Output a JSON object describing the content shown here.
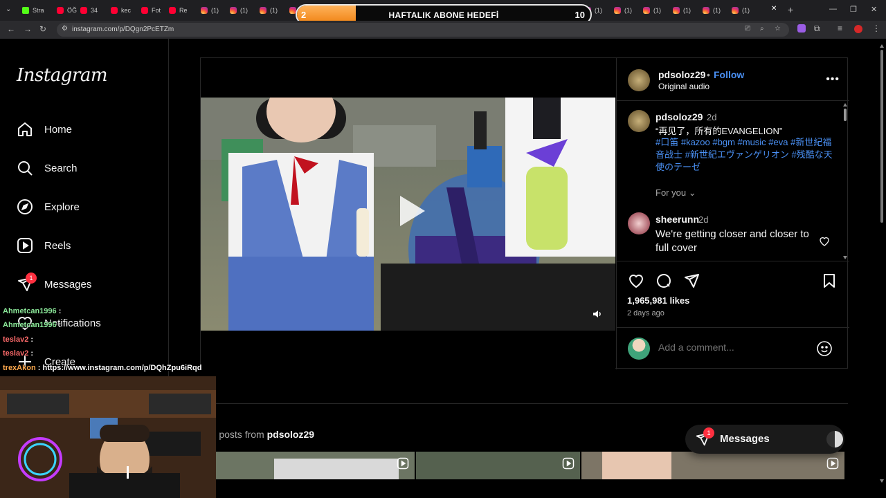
{
  "browser": {
    "tabs": [
      {
        "icon": "kick",
        "title": "Stra"
      },
      {
        "icon": "youtube",
        "title": "ÖĞ"
      },
      {
        "icon": "youtube",
        "title": "34"
      },
      {
        "icon": "youtube",
        "title": "kec"
      },
      {
        "icon": "youtube",
        "title": "Fot"
      },
      {
        "icon": "youtube",
        "title": "Re"
      },
      {
        "icon": "instagram",
        "title": "(1)"
      },
      {
        "icon": "instagram",
        "title": "(1)"
      },
      {
        "icon": "instagram",
        "title": "(1)"
      },
      {
        "icon": "instagram",
        "title": "(1)"
      },
      {
        "icon": "instagram",
        "title": "(1)"
      },
      {
        "icon": "instagram",
        "title": "(1)"
      },
      {
        "icon": "instagram",
        "title": "(1)"
      },
      {
        "icon": "instagram",
        "title": "(1)"
      },
      {
        "icon": "instagram",
        "title": "(1)"
      },
      {
        "icon": "instagram",
        "title": "(1)"
      },
      {
        "icon": "instagram",
        "title": "(1)"
      },
      {
        "icon": "instagram",
        "title": "(1)"
      },
      {
        "icon": "instagram",
        "title": "(1)"
      },
      {
        "icon": "instagram",
        "title": "(1)"
      },
      {
        "icon": "instagram",
        "title": "(1)"
      },
      {
        "icon": "instagram",
        "title": "(1)"
      },
      {
        "icon": "instagram",
        "title": "(1)"
      },
      {
        "icon": "instagram",
        "title": "(1)"
      },
      {
        "icon": "instagram",
        "title": "(1)"
      }
    ],
    "url": "instagram.com/p/DQgn2PcETZm",
    "tab_dropdown": "⌄",
    "new_tab": "+"
  },
  "goal": {
    "title": "HAFTALIK ABONE HEDEFİ",
    "current": "2",
    "target": "10",
    "progress_fraction": 0.2,
    "accent": "#f08314"
  },
  "sidebar": {
    "logo": "Instagram",
    "items": [
      {
        "icon": "home-icon",
        "label": "Home"
      },
      {
        "icon": "search-icon",
        "label": "Search"
      },
      {
        "icon": "explore-icon",
        "label": "Explore"
      },
      {
        "icon": "reels-icon",
        "label": "Reels"
      },
      {
        "icon": "messages-icon",
        "label": "Messages",
        "badge": "1"
      },
      {
        "icon": "heart-icon",
        "label": "Notifications"
      },
      {
        "icon": "plus-icon",
        "label": "Create"
      }
    ]
  },
  "post": {
    "username": "pdsoloz29",
    "separator": "•",
    "follow_label": "Follow",
    "audio": "Original audio",
    "more": "•••",
    "caption": {
      "username": "pdsoloz29",
      "time": "2d",
      "text": "“再见了，所有的EVANGELION”",
      "tags": "#口笛 #kazoo #bgm #music #eva #新世紀福音战士 #新世紀エヴァンゲリオン #残酷な天使のテーゼ"
    },
    "for_you": "For you",
    "comment": {
      "username": "sheerunn",
      "time": "2d",
      "text": "We're getting closer and closer to full cover"
    },
    "likes": "1,965,981 likes",
    "posted": "2 days ago",
    "comment_placeholder": "Add a comment..."
  },
  "more_posts": {
    "prefix": "re posts from",
    "username": "pdsoloz29"
  },
  "messages_float": {
    "label": "Messages",
    "badge": "1"
  },
  "stream_chat": [
    {
      "user": "Ahmetcan1996",
      "text": ":",
      "color": "#8ce99a"
    },
    {
      "user": "Ahmetcan1996",
      "text": ":",
      "color": "#8ce99a"
    },
    {
      "user": "teslav2",
      "text": ":",
      "color": "#ff6b6b"
    },
    {
      "user": "teslav2",
      "text": ":",
      "color": "#ff6b6b"
    },
    {
      "user": "trexAkon",
      "text": ": https://www.instagram.com/p/DQhZpu6iRqd",
      "color": "#ffa94d"
    }
  ],
  "colors": {
    "link_blue": "#4a90f4",
    "badge_red": "#ff3040",
    "border": "#262626"
  }
}
